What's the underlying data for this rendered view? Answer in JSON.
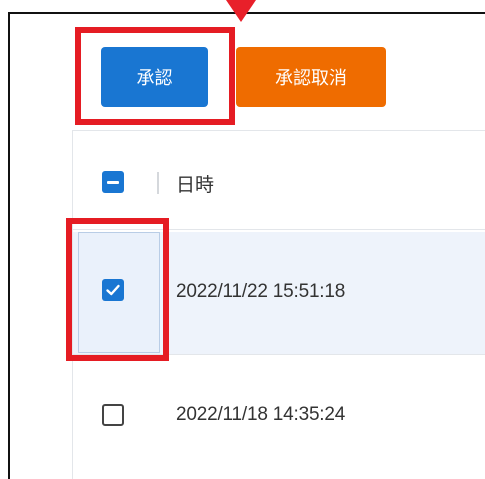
{
  "toolbar": {
    "approve_label": "承認",
    "cancel_approval_label": "承認取消"
  },
  "table": {
    "header": {
      "datetime": "日時",
      "select_all_state": "indeterminate"
    },
    "rows": [
      {
        "datetime": "2022/11/22 15:51:18",
        "checked": true
      },
      {
        "datetime": "2022/11/18 14:35:24",
        "checked": false
      }
    ]
  },
  "colors": {
    "primary": "#1976d2",
    "secondary": "#ef6c00",
    "highlight": "#e51c23",
    "selected_row": "#eef3fb"
  }
}
